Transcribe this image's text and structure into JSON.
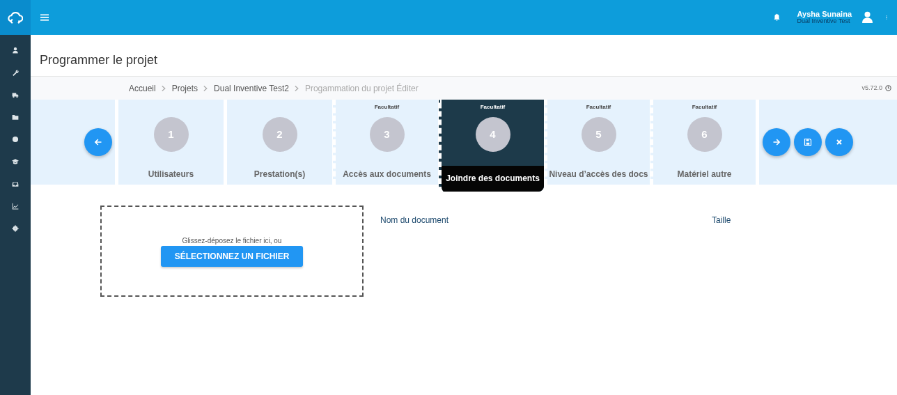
{
  "topbar": {
    "user_name": "Aysha Sunaina",
    "user_org": "Dual Inventive Test"
  },
  "page_title": "Programmer le projet",
  "breadcrumb": [
    {
      "label": "Accueil",
      "current": false
    },
    {
      "label": "Projets",
      "current": false
    },
    {
      "label": "Dual Inventive Test2",
      "current": false
    },
    {
      "label": "Progammation du projet Éditer",
      "current": true
    }
  ],
  "version": "v5.72.0",
  "steps": [
    {
      "number": "1",
      "label": "Utilisateurs",
      "selected": false
    },
    {
      "number": "2",
      "label": "Prestation(s)",
      "selected": false
    },
    {
      "number": "3",
      "label": "Accès aux documents",
      "note": "Facultatif",
      "selected": false
    },
    {
      "number": "4",
      "label": "Joindre des documents",
      "note": "Facultatif",
      "selected": true
    },
    {
      "number": "5",
      "label": "Niveau d’accès des docs",
      "note": "Facultatif",
      "selected": false
    },
    {
      "number": "6",
      "label": "Matériel autre",
      "note": "Facultatif",
      "selected": false
    }
  ],
  "dropzone": {
    "hint": "Glissez-déposez le fichier ici, ou",
    "button": "SÉLECTIONNEZ UN FICHIER"
  },
  "table": {
    "columns": [
      "Nom du document",
      "Taille"
    ]
  }
}
